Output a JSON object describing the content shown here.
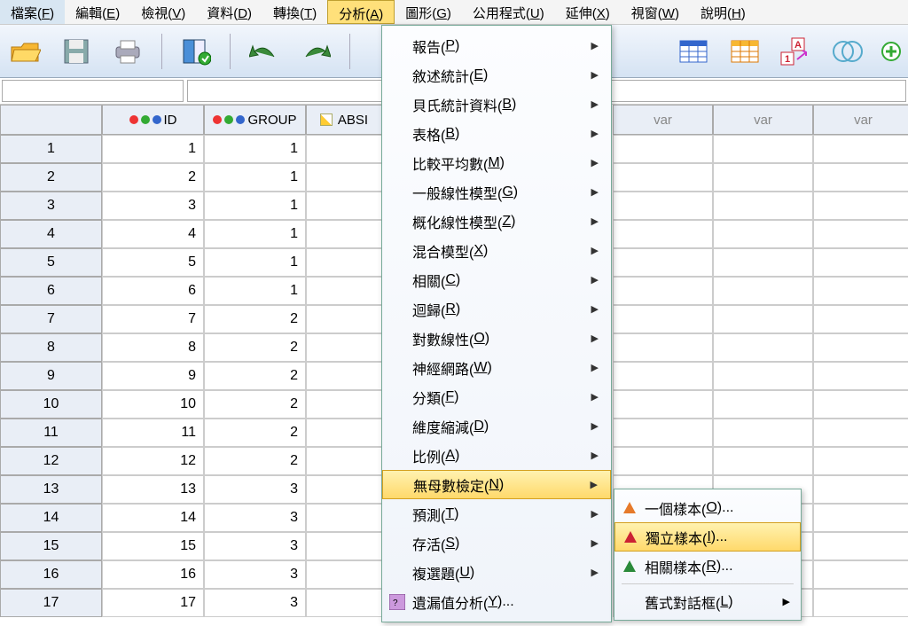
{
  "menubar": [
    {
      "label": "檔案(",
      "key": "F",
      "end": ")"
    },
    {
      "label": "編輯(",
      "key": "E",
      "end": ")"
    },
    {
      "label": "檢視(",
      "key": "V",
      "end": ")"
    },
    {
      "label": "資料(",
      "key": "D",
      "end": ")"
    },
    {
      "label": "轉換(",
      "key": "T",
      "end": ")"
    },
    {
      "label": "分析(",
      "key": "A",
      "end": ")",
      "active": true
    },
    {
      "label": "圖形(",
      "key": "G",
      "end": ")"
    },
    {
      "label": "公用程式(",
      "key": "U",
      "end": ")"
    },
    {
      "label": "延伸(",
      "key": "X",
      "end": ")"
    },
    {
      "label": "視窗(",
      "key": "W",
      "end": ")"
    },
    {
      "label": "說明(",
      "key": "H",
      "end": ")"
    }
  ],
  "columns": {
    "id": "ID",
    "group": "GROUP",
    "absi": "ABSI",
    "var": "var"
  },
  "rows": [
    {
      "n": "1",
      "id": "1",
      "group": "1"
    },
    {
      "n": "2",
      "id": "2",
      "group": "1"
    },
    {
      "n": "3",
      "id": "3",
      "group": "1"
    },
    {
      "n": "4",
      "id": "4",
      "group": "1"
    },
    {
      "n": "5",
      "id": "5",
      "group": "1"
    },
    {
      "n": "6",
      "id": "6",
      "group": "1"
    },
    {
      "n": "7",
      "id": "7",
      "group": "2"
    },
    {
      "n": "8",
      "id": "8",
      "group": "2"
    },
    {
      "n": "9",
      "id": "9",
      "group": "2"
    },
    {
      "n": "10",
      "id": "10",
      "group": "2"
    },
    {
      "n": "11",
      "id": "11",
      "group": "2"
    },
    {
      "n": "12",
      "id": "12",
      "group": "2"
    },
    {
      "n": "13",
      "id": "13",
      "group": "3"
    },
    {
      "n": "14",
      "id": "14",
      "group": "3"
    },
    {
      "n": "15",
      "id": "15",
      "group": "3"
    },
    {
      "n": "16",
      "id": "16",
      "group": "3"
    },
    {
      "n": "17",
      "id": "17",
      "group": "3"
    }
  ],
  "dropdown": [
    {
      "label": "報告(",
      "key": "P",
      "end": ")",
      "sub": true
    },
    {
      "label": "敘述統計(",
      "key": "E",
      "end": ")",
      "sub": true
    },
    {
      "label": "貝氏統計資料(",
      "key": "B",
      "end": ")",
      "sub": true
    },
    {
      "label": "表格(",
      "key": "B",
      "end": ")",
      "sub": true
    },
    {
      "label": "比較平均數(",
      "key": "M",
      "end": ")",
      "sub": true
    },
    {
      "label": "一般線性模型(",
      "key": "G",
      "end": ")",
      "sub": true
    },
    {
      "label": "概化線性模型(",
      "key": "Z",
      "end": ")",
      "sub": true
    },
    {
      "label": "混合模型(",
      "key": "X",
      "end": ")",
      "sub": true
    },
    {
      "label": "相關(",
      "key": "C",
      "end": ")",
      "sub": true
    },
    {
      "label": "迴歸(",
      "key": "R",
      "end": ")",
      "sub": true
    },
    {
      "label": "對數線性(",
      "key": "O",
      "end": ")",
      "sub": true
    },
    {
      "label": "神經網路(",
      "key": "W",
      "end": ")",
      "sub": true
    },
    {
      "label": "分類(",
      "key": "F",
      "end": ")",
      "sub": true
    },
    {
      "label": "維度縮減(",
      "key": "D",
      "end": ")",
      "sub": true
    },
    {
      "label": "比例(",
      "key": "A",
      "end": ")",
      "sub": true
    },
    {
      "label": "無母數檢定(",
      "key": "N",
      "end": ")",
      "sub": true,
      "hot": true
    },
    {
      "label": "預測(",
      "key": "T",
      "end": ")",
      "sub": true
    },
    {
      "label": "存活(",
      "key": "S",
      "end": ")",
      "sub": true
    },
    {
      "label": "複選題(",
      "key": "U",
      "end": ")",
      "sub": true
    },
    {
      "label": "遺漏值分析(",
      "key": "Y",
      "end": ")...",
      "sub": false,
      "icon": true
    }
  ],
  "submenu": [
    {
      "label": "一個樣本(",
      "key": "O",
      "end": ")...",
      "color": "#e67a2a"
    },
    {
      "label": "獨立樣本(",
      "key": "I",
      "end": ")...",
      "color": "#c23",
      "color2": "#23c",
      "hot": true
    },
    {
      "label": "相關樣本(",
      "key": "R",
      "end": ")...",
      "color": "#2a8a3a"
    },
    {
      "label": "舊式對話框(",
      "key": "L",
      "end": ")",
      "arrow": true,
      "sep": true
    }
  ]
}
